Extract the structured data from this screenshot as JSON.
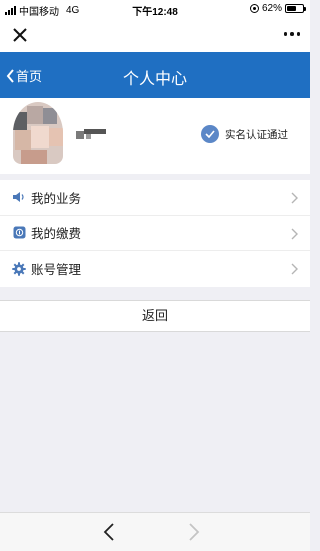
{
  "status_bar": {
    "carrier": "中国移动",
    "network": "4G",
    "time": "下午12:48",
    "battery": "62%",
    "battery_level": 0.62
  },
  "header": {
    "back_label": "首页",
    "title": "个人中心"
  },
  "profile": {
    "verified_label": "实名认证通过"
  },
  "menu": {
    "items": [
      {
        "label": "我的业务",
        "icon": "speaker-icon"
      },
      {
        "label": "我的缴费",
        "icon": "payment-icon"
      },
      {
        "label": "账号管理",
        "icon": "gear-icon"
      }
    ]
  },
  "actions": {
    "return_label": "返回"
  },
  "colors": {
    "header_blue": "#1f6fc2",
    "icon_blue": "#4a78b8",
    "verified_blue": "#5b87c7"
  }
}
